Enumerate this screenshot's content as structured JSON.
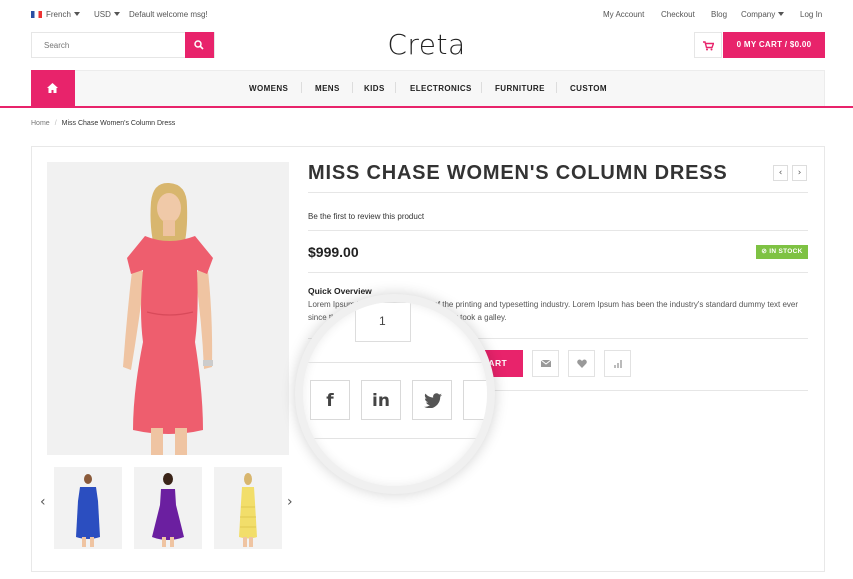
{
  "topbar": {
    "language": "French",
    "currency": "USD",
    "welcome": "Default welcome msg!",
    "links": {
      "account": "My Account",
      "checkout": "Checkout",
      "blog": "Blog",
      "company": "Company",
      "login": "Log In"
    }
  },
  "header": {
    "search_placeholder": "Search",
    "logo": "Creta",
    "cart_label": "0   MY CART / $0.00"
  },
  "nav": {
    "items": [
      "WOMENS",
      "MENS",
      "KIDS",
      "ELECTRONICS",
      "FURNITURE",
      "CUSTOM"
    ]
  },
  "breadcrumb": {
    "home": "Home",
    "separator": "/",
    "current": "Miss Chase Women's Column Dress"
  },
  "product": {
    "title": "MISS CHASE WOMEN'S COLUMN DRESS",
    "review_link": "Be the first to review this product",
    "price": "$999.00",
    "stock": "IN STOCK",
    "overview_title": "Quick Overview",
    "overview_text": "Lorem Ipsum is simply dummy text of the printing and typesetting industry. Lorem Ipsum has been the industry's standard dummy text ever since the 1500s, when an unknown printer took a galley.",
    "add_to_cart": "CART",
    "qty": "1",
    "thumbnails": [
      "Blue dress",
      "Purple dress",
      "Yellow dress"
    ]
  },
  "social": {
    "buttons": [
      "f",
      "in"
    ]
  },
  "colors": {
    "accent": "#e8236b",
    "stock_green": "#7ec243"
  },
  "icons": [
    "search-icon",
    "cart-icon",
    "home-icon",
    "email-icon",
    "heart-icon",
    "compare-icon",
    "facebook-icon",
    "linkedin-icon",
    "twitter-icon",
    "chevron-left-icon",
    "chevron-right-icon",
    "check-circle-icon"
  ]
}
